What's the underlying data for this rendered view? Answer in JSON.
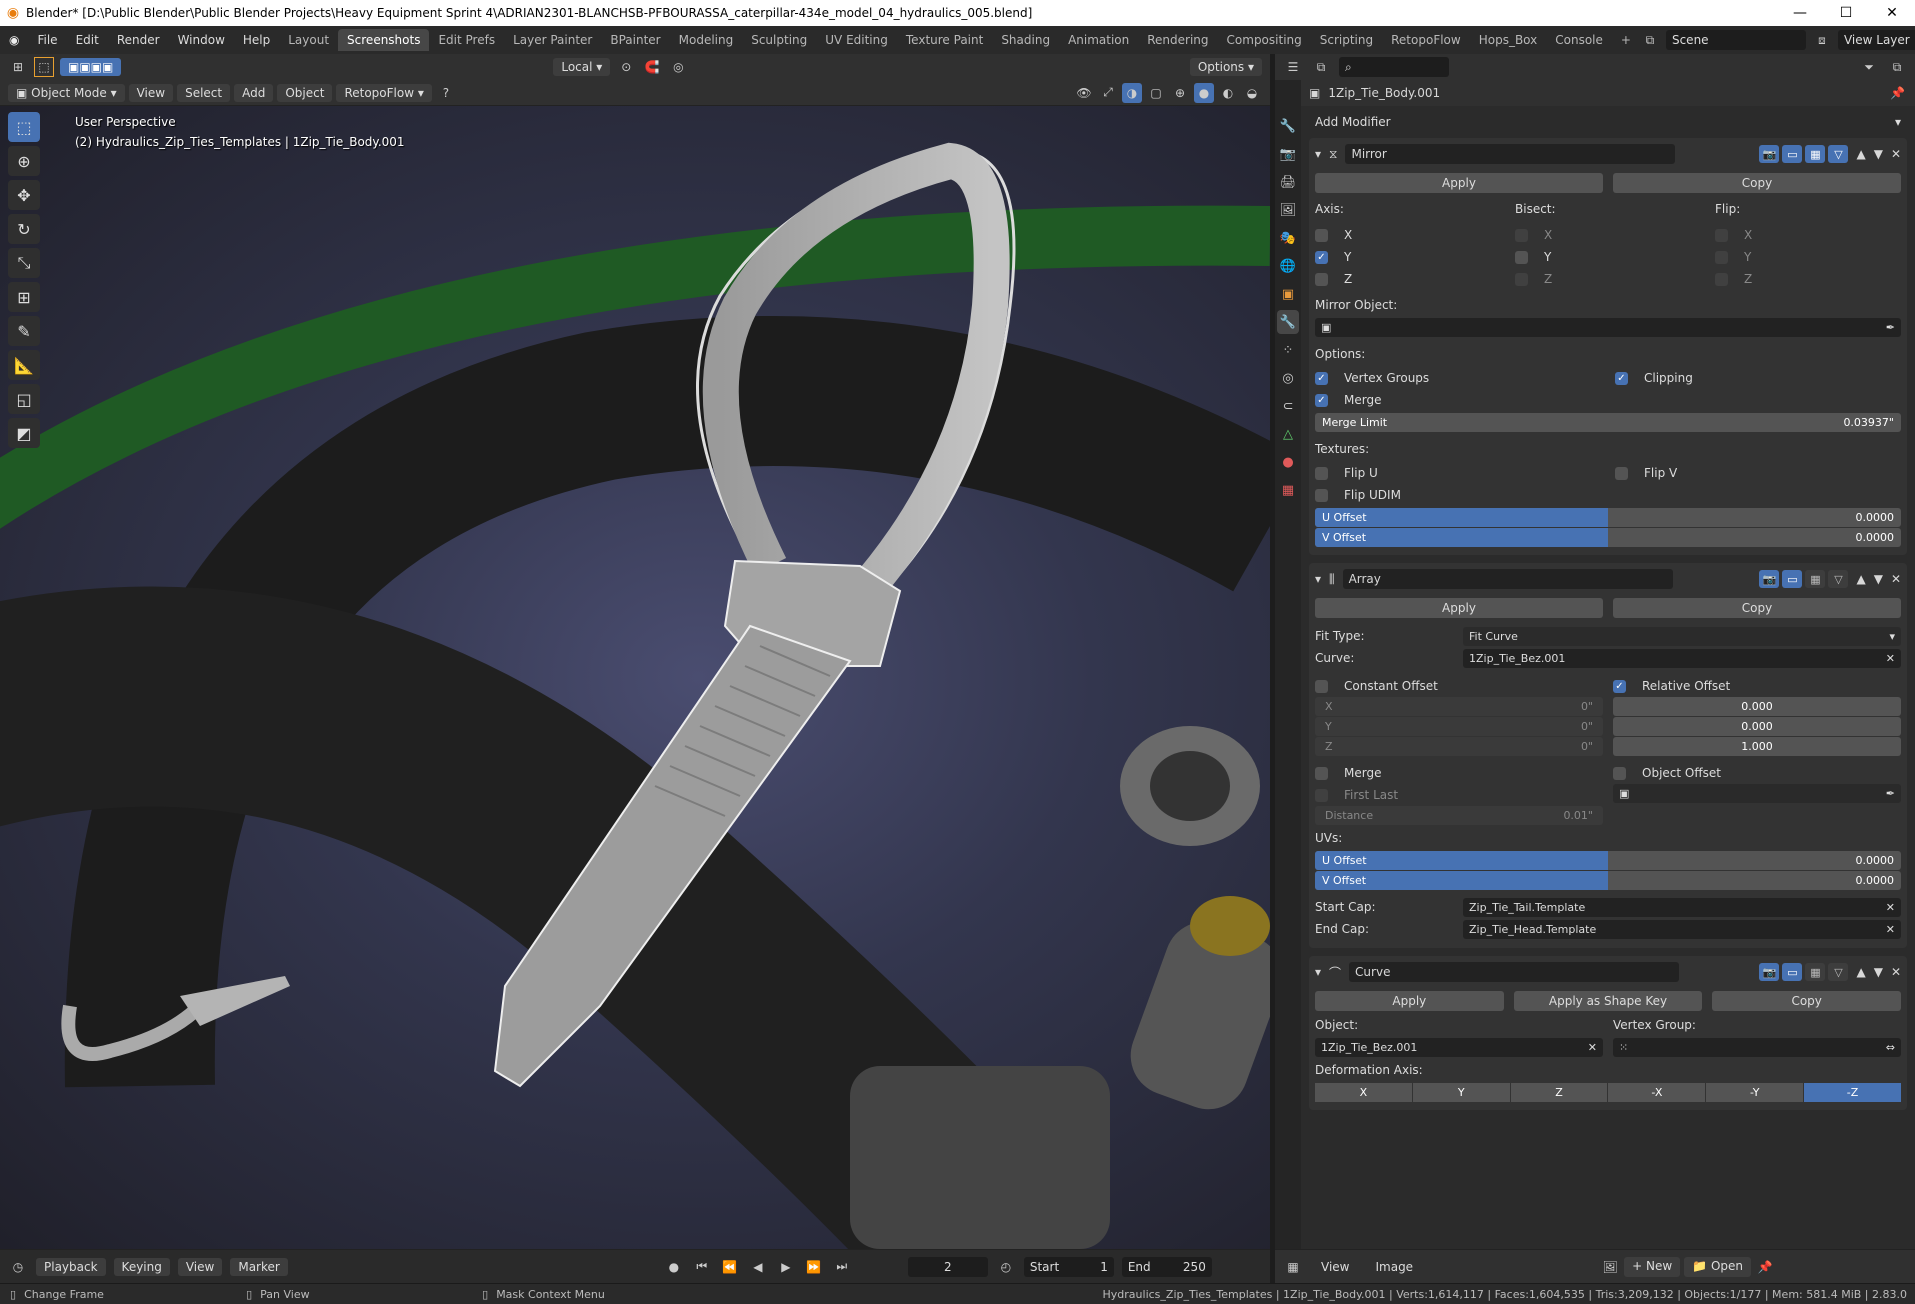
{
  "window": {
    "title": "Blender* [D:\\Public Blender\\Public Blender Projects\\Heavy Equipment Sprint 4\\ADRIAN2301-BLANCHSB-PFBOURASSA_caterpillar-434e_model_04_hydraulics_005.blend]"
  },
  "menu": [
    "File",
    "Edit",
    "Render",
    "Window",
    "Help"
  ],
  "workspaces": [
    "Layout",
    "Screenshots",
    "Edit Prefs",
    "Layer Painter",
    "BPainter",
    "Modeling",
    "Sculpting",
    "UV Editing",
    "Texture Paint",
    "Shading",
    "Animation",
    "Rendering",
    "Compositing",
    "Scripting",
    "RetopoFlow",
    "Hops_Box",
    "Console"
  ],
  "scene": "Scene",
  "view_layer": "View Layer",
  "viewport": {
    "orientation": "Local",
    "options_label": "Options",
    "mode": "Object Mode",
    "menus": [
      "View",
      "Select",
      "Add",
      "Object"
    ],
    "retopoflow": "RetopoFlow",
    "perspective": "User Perspective",
    "object_info": "(2) Hydraulics_Zip_Ties_Templates | 1Zip_Tie_Body.001"
  },
  "timeline": {
    "menus": [
      "Playback",
      "Keying",
      "View",
      "Marker"
    ],
    "frame": "2",
    "start_label": "Start",
    "start": "1",
    "end_label": "End",
    "end": "250"
  },
  "status": {
    "change_frame": "Change Frame",
    "pan_view": "Pan View",
    "mask_menu": "Mask Context Menu",
    "stats": "Hydraulics_Zip_Ties_Templates | 1Zip_Tie_Body.001 | Verts:1,614,117 | Faces:1,604,535 | Tris:3,209,132 | Objects:1/177 | Mem: 581.4 MiB | 2.83.0"
  },
  "props": {
    "object_name": "1Zip_Tie_Body.001",
    "add_modifier": "Add Modifier",
    "mirror": {
      "name": "Mirror",
      "apply": "Apply",
      "copy": "Copy",
      "axis_label": "Axis:",
      "bisect_label": "Bisect:",
      "flip_label": "Flip:",
      "axes": [
        "X",
        "Y",
        "Z"
      ],
      "mirror_object_label": "Mirror Object:",
      "options_label": "Options:",
      "vertex_groups": "Vertex Groups",
      "clipping": "Clipping",
      "merge": "Merge",
      "merge_limit_label": "Merge Limit",
      "merge_limit": "0.03937\"",
      "textures_label": "Textures:",
      "flip_u": "Flip U",
      "flip_v": "Flip V",
      "flip_udim": "Flip UDIM",
      "u_offset_label": "U Offset",
      "u_offset": "0.0000",
      "v_offset_label": "V Offset",
      "v_offset": "0.0000"
    },
    "array": {
      "name": "Array",
      "apply": "Apply",
      "copy": "Copy",
      "fit_type_label": "Fit Type:",
      "fit_type": "Fit Curve",
      "curve_label": "Curve:",
      "curve": "1Zip_Tie_Bez.001",
      "constant_offset": "Constant Offset",
      "relative_offset": "Relative Offset",
      "const_x": "X",
      "const_y": "Y",
      "const_z": "Z",
      "const_val": "0\"",
      "rel_x": "0.000",
      "rel_y": "0.000",
      "rel_z": "1.000",
      "merge": "Merge",
      "object_offset": "Object Offset",
      "first_last": "First Last",
      "distance_label": "Distance",
      "distance": "0.01\"",
      "uvs_label": "UVs:",
      "u_offset_label": "U Offset",
      "u_offset": "0.0000",
      "v_offset_label": "V Offset",
      "v_offset": "0.0000",
      "start_cap_label": "Start Cap:",
      "start_cap": "Zip_Tie_Tail.Template",
      "end_cap_label": "End Cap:",
      "end_cap": "Zip_Tie_Head.Template"
    },
    "curve": {
      "name": "Curve",
      "apply": "Apply",
      "apply_shape": "Apply as Shape Key",
      "copy": "Copy",
      "object_label": "Object:",
      "object": "1Zip_Tie_Bez.001",
      "vertex_group_label": "Vertex Group:",
      "deformation_label": "Deformation Axis:",
      "axes": [
        "X",
        "Y",
        "Z",
        "-X",
        "-Y",
        "-Z"
      ]
    }
  },
  "image_editor": {
    "view": "View",
    "image": "Image",
    "new": "New",
    "open": "Open"
  }
}
